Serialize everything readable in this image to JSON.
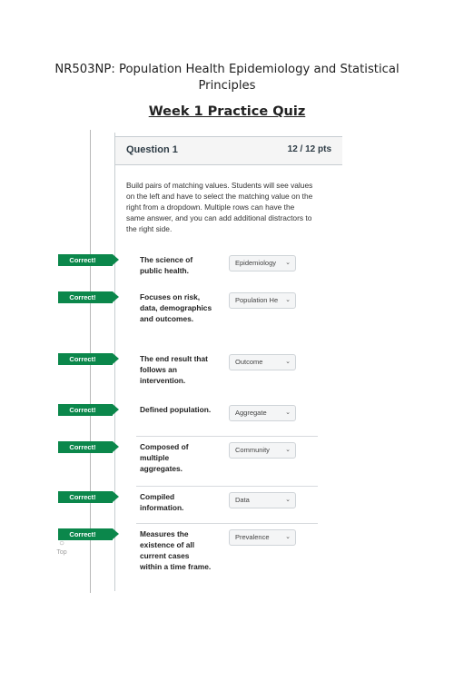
{
  "document": {
    "title": "NR503NP: Population Health Epidemiology and Statistical Principles",
    "quiz_title": "Week 1 Practice Quiz"
  },
  "question": {
    "name": "Question 1",
    "points": "12 / 12 pts",
    "instructions": "Build pairs of matching values. Students will see values on the left and have to select the matching value on the right from a dropdown. Multiple rows can have the same answer, and you can add additional distractors to the right side.",
    "rows": [
      {
        "status": "Correct!",
        "prompt": "The science of public health.",
        "answer": "Epidemiology"
      },
      {
        "status": "Correct!",
        "prompt": "Focuses on risk, data, demographics and outcomes.",
        "answer": "Population He"
      },
      {
        "status": "Correct!",
        "prompt": "The end result that follows an intervention.",
        "answer": "Outcome"
      },
      {
        "status": "Correct!",
        "prompt": "Defined population.",
        "answer": "Aggregate"
      },
      {
        "status": "Correct!",
        "prompt": "Composed of multiple aggregates.",
        "answer": "Community"
      },
      {
        "status": "Correct!",
        "prompt": "Compiled information.",
        "answer": "Data"
      },
      {
        "status": "Correct!",
        "prompt": "Measures the existence of all current cases within a time frame.",
        "answer": "Prevalence"
      }
    ]
  },
  "nav": {
    "top_label": "Top",
    "top_icon": "chevron-up-circle-icon"
  }
}
